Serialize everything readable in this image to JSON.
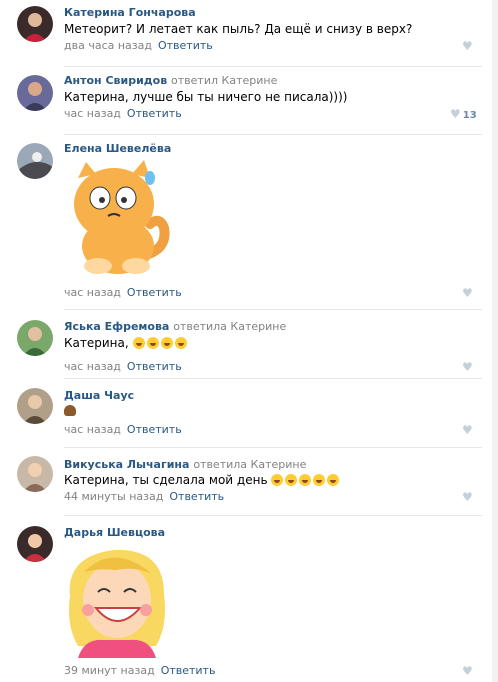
{
  "reply_label": "Ответить",
  "comments": [
    {
      "author": "Катерина Гончарова",
      "replied": "",
      "text": "Метеорит? И летает как пыль? Да ещё и снизу в верх?",
      "time": "два часа назад",
      "likes": ""
    },
    {
      "author": "Антон Свиридов",
      "replied": "ответил Катерине",
      "text": "Катерина, лучше бы ты ничего не писала))))",
      "time": "час назад",
      "likes": "13"
    },
    {
      "author": "Елена Шевелёва",
      "replied": "",
      "text": "",
      "time": "час назад",
      "likes": ""
    },
    {
      "author": "Яська Ефремова",
      "replied": "ответила Катерине",
      "text": "Катерина,",
      "time": "час назад",
      "likes": ""
    },
    {
      "author": "Даша Чаус",
      "replied": "",
      "text": "",
      "time": "час назад",
      "likes": ""
    },
    {
      "author": "Викуська Лычагина",
      "replied": "ответила Катерине",
      "text": "Катерина, ты сделала мой день",
      "time": "44 минуты назад",
      "likes": ""
    },
    {
      "author": "Дарья Шевцова",
      "replied": "",
      "text": "",
      "time": "39 минут назад",
      "likes": ""
    }
  ],
  "icons": {
    "like": "heart-icon",
    "laugh": "tears-of-joy-emoji",
    "poop": "poop-emoji",
    "sticker1": "cat-sticker",
    "sticker2": "girl-sticker"
  }
}
